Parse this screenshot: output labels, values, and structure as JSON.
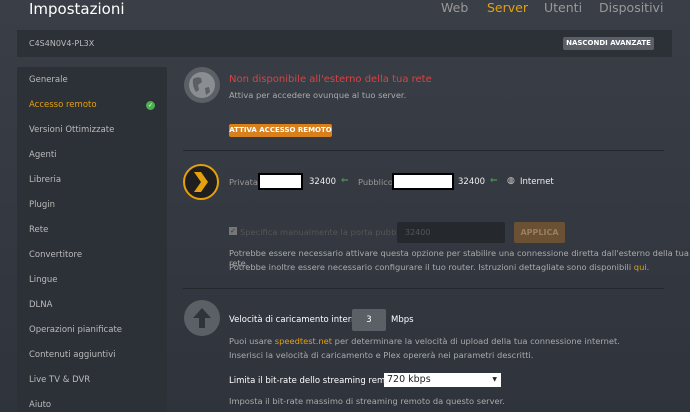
{
  "header": {
    "title": "Impostazioni",
    "tabs": [
      {
        "label": "Web",
        "active": false
      },
      {
        "label": "Server",
        "active": true
      },
      {
        "label": "Utenti",
        "active": false
      },
      {
        "label": "Dispositivi",
        "active": false
      }
    ]
  },
  "topbar": {
    "server_id": "C4S4N0V4-PL3X",
    "hide_advanced": "NASCONDI AVANZATE"
  },
  "sidebar": {
    "items": [
      "Generale",
      "Accesso remoto",
      "Versioni Ottimizzate",
      "Agenti",
      "Libreria",
      "Plugin",
      "Rete",
      "Convertitore",
      "Lingue",
      "DLNA",
      "Operazioni pianificate",
      "Contenuti aggiuntivi",
      "Live TV & DVR",
      "Aiuto"
    ],
    "active_index": 1
  },
  "remote": {
    "status": "Non disponibile all'esterno della tua rete",
    "subtitle": "Attiva per accedere ovunque al tuo server.",
    "enable_button": "ATTIVA ACCESSO REMOTO"
  },
  "connection": {
    "private_label": "Privata",
    "private_port": "32400",
    "public_label": "Pubblico",
    "public_port": "32400",
    "internet_label": "Internet"
  },
  "manual_port": {
    "checkbox_label": "Specifica manualmente la porta pubblica",
    "checked": true,
    "placeholder": "32400",
    "apply": "APPLICA",
    "help1": "Potrebbe essere necessario attivare questa opzione per stabilire una connessione diretta dall'esterno della tua rete.",
    "help2": "Potrebbe inoltre essere necessario configurare il tuo router. Istruzioni dettagliate sono disponibili ",
    "help2_link": "qui",
    "help2_end": "."
  },
  "upload": {
    "label": "Velocità di caricamento internet",
    "value": "3",
    "unit": "Mbps",
    "help1_pre": "Puoi usare ",
    "help1_link": "speedtest.net",
    "help1_post": " per determinare la velocità di upload della tua connessione internet.",
    "help2": "Inserisci la velocità di caricamento e Plex opererà nei parametri descritti."
  },
  "bitrate": {
    "label": "Limita il bit-rate dello streaming remoto",
    "selected": "720 kbps",
    "help": "Imposta il bit-rate massimo di streaming remoto da questo server."
  }
}
